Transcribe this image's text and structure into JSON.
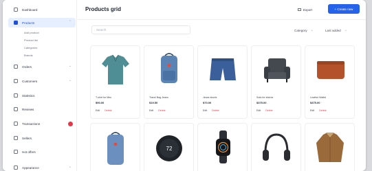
{
  "sidebar": {
    "items": [
      {
        "label": "Dashboard"
      },
      {
        "label": "Products"
      },
      {
        "label": "Orders"
      },
      {
        "label": "Customers"
      },
      {
        "label": "Statistics"
      },
      {
        "label": "Reviews"
      },
      {
        "label": "Transactions"
      },
      {
        "label": "Sellers"
      },
      {
        "label": "Hot offers"
      },
      {
        "label": "Appearance"
      }
    ],
    "product_subitems": [
      "Add product",
      "Product list",
      "Categories",
      "Brands"
    ]
  },
  "header": {
    "title": "Products grid",
    "export_label": "Export",
    "create_label": "+ Create new"
  },
  "toolbar": {
    "search_placeholder": "Search",
    "category_label": "Category",
    "sort_label": "Last added"
  },
  "products": [
    {
      "name": "T-shirt for Men",
      "price": "$90.00",
      "image": "polo-shirt-icon"
    },
    {
      "name": "Travel Bag Jeans",
      "price": "$19.50",
      "image": "backpack-icon"
    },
    {
      "name": "Jeans shorts",
      "price": "$70.00",
      "image": "shorts-icon"
    },
    {
      "name": "Sofa for interior",
      "price": "$375.00",
      "image": "armchair-icon"
    },
    {
      "name": "Leather Wallet",
      "price": "$375.00",
      "image": "wallet-icon"
    },
    {
      "name": "",
      "price": "",
      "image": "backpack-icon"
    },
    {
      "name": "",
      "price": "",
      "image": "thermostat-icon"
    },
    {
      "name": "",
      "price": "",
      "image": "smartwatch-icon"
    },
    {
      "name": "",
      "price": "",
      "image": "headphones-icon"
    },
    {
      "name": "",
      "price": "",
      "image": "jacket-icon"
    }
  ],
  "card_actions": {
    "edit": "Edit",
    "delete": "Delete"
  },
  "thermostat_display": "72",
  "colors": {
    "accent": "#2563eb",
    "danger": "#e5384d",
    "active_bg": "#e6efff"
  }
}
